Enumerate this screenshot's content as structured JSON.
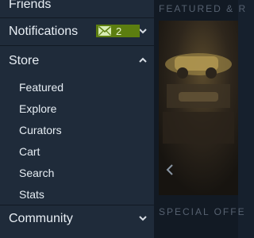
{
  "nav": {
    "friends": "Friends",
    "notifications": "Notifications",
    "notifications_badge": "2",
    "store": "Store",
    "store_items": [
      "Featured",
      "Explore",
      "Curators",
      "Cart",
      "Search",
      "Stats"
    ],
    "community": "Community"
  },
  "content": {
    "featured_header": "FEATURED & R",
    "special_header": "SPECIAL OFFE"
  },
  "colors": {
    "sidebar_bg": "#1f2b3a",
    "badge_bg": "#5c7e10",
    "text": "#e6edf3",
    "muted_header": "#566170"
  }
}
